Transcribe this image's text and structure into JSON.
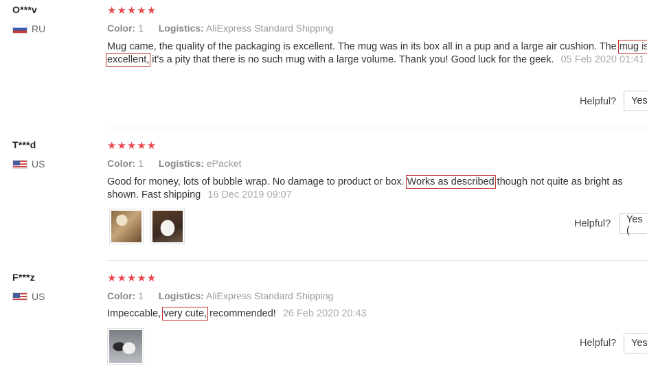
{
  "reviews": [
    {
      "user": "O***v",
      "country": "RU",
      "flag_icon": "russia-flag-icon",
      "stars": "★★★★★",
      "color_label": "Color:",
      "color_value": "1",
      "logistics_label": "Logistics:",
      "logistics_value": "AliExpress Standard Shipping",
      "text_a": "Mug came, the quality of the packaging is excellent. The mug was in its box all in a pup and a large air cushion. The ",
      "highlight": "mug is excellent,",
      "text_b": " it's a pity that there is no such mug with a large volume. Thank you! Good luck for the geek. ",
      "date": "05 Feb 2020 01:41",
      "helpful_label": "Helpful?",
      "yes_label": "Yes"
    },
    {
      "user": "T***d",
      "country": "US",
      "flag_icon": "usa-flag-icon",
      "stars": "★★★★★",
      "color_label": "Color:",
      "color_value": "1",
      "logistics_label": "Logistics:",
      "logistics_value": "ePacket",
      "text_a": "Good for money, lots of bubble wrap. No damage to product or box. ",
      "highlight": "Works as described",
      "text_b": " though not quite as bright as shown. Fast shipping ",
      "date": "16 Dec 2019 09:07",
      "helpful_label": "Helpful?",
      "yes_label": "Yes ("
    },
    {
      "user": "F***z",
      "country": "US",
      "flag_icon": "usa-flag-icon",
      "stars": "★★★★★",
      "color_label": "Color:",
      "color_value": "1",
      "logistics_label": "Logistics:",
      "logistics_value": "AliExpress Standard Shipping",
      "text_a": "Impeccable, ",
      "highlight": "very cute,",
      "text_b": " recommended! ",
      "date": "26 Feb 2020 20:43",
      "helpful_label": "Helpful?",
      "yes_label": "Yes"
    }
  ],
  "colors": {
    "star": "#e8474d",
    "highlight_box": "#c0322f"
  }
}
